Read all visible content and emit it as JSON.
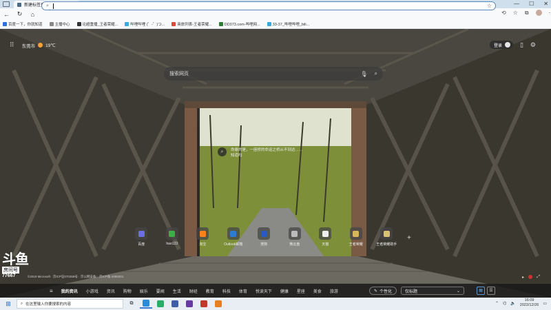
{
  "browser": {
    "tab_title": "新建标签页",
    "new_tab_symbol": "+",
    "close_symbol": "×",
    "window_controls": [
      "—",
      "☐",
      "✕"
    ],
    "nav": {
      "back": "←",
      "forward": "→",
      "refresh": "↻",
      "home": "⌂"
    },
    "address_value": "",
    "address_icon": "search-icon",
    "star": "☆",
    "right_icons": [
      "⟲",
      "☆",
      "⧉"
    ]
  },
  "bookmarks": [
    {
      "label": "百度一下，你就知道",
      "color": "#2f6fdc"
    },
    {
      "label": "主播中心",
      "color": "#888888"
    },
    {
      "label": "论超重播_王者荣耀...",
      "color": "#333333"
    },
    {
      "label": "哔哩哔哩 (゜-゜)つ...",
      "color": "#3da7e0"
    },
    {
      "label": "商旅列表-王者荣耀...",
      "color": "#d9493a"
    },
    {
      "label": "DD373.com-哔哩网...",
      "color": "#2e7d32"
    },
    {
      "label": "33-37_哔哩哔哩_bili...",
      "color": "#3da7e0"
    }
  ],
  "page": {
    "city": "东莞市",
    "temperature": "19℃",
    "login_label": "登录",
    "search_placeholder": "搜索网页",
    "info_line1": "命悬的是，一座桥的命运之桥从不到达……",
    "info_line2": "知道吗",
    "tiles": [
      {
        "label": "百度",
        "color": "#6b6fe0"
      },
      {
        "label": "hao123",
        "color": "#3fae49"
      },
      {
        "label": "淘宝",
        "color": "#f58220"
      },
      {
        "label": "Outlook邮箱",
        "color": "#2c7cd6"
      },
      {
        "label": "搜狗",
        "color": "#2b59c3"
      },
      {
        "label": "微云盘",
        "color": "#bbbbbb"
      },
      {
        "label": "天猫",
        "color": "#eeeeee"
      },
      {
        "label": "王者荣耀",
        "color": "#d8b65b"
      },
      {
        "label": "王者荣耀助手",
        "color": "#d8c27a"
      }
    ],
    "add_symbol": "+",
    "watermark_logo": "斗鱼",
    "watermark_sub": "房间号",
    "watermark_num": "77667",
    "copyright": "©2019 Microsoft · 京ICP证070359号 · 京公网安备：京ICP备-2085001",
    "feed_categories": [
      "我的资讯",
      "小游戏",
      "资讯",
      "购物",
      "娱乐",
      "要闻",
      "生活",
      "财经",
      "教育",
      "科技",
      "体育",
      "悦读天下",
      "健康",
      "星座",
      "美食",
      "旅游"
    ],
    "personalize_label": "个性化",
    "layout_select": "仅标题",
    "view_modes": [
      "▦",
      "☰"
    ]
  },
  "taskbar": {
    "start_symbol": "⊞",
    "search_placeholder": "在这里输入你要搜索的内容",
    "apps": [
      {
        "name": "edge",
        "color": "#2a8bd9"
      },
      {
        "name": "wechat",
        "color": "#2aae67"
      },
      {
        "name": "app3",
        "color": "#3f5ea7"
      },
      {
        "name": "app4",
        "color": "#6a3aa3"
      },
      {
        "name": "app5",
        "color": "#c0392b"
      },
      {
        "name": "app6",
        "color": "#e67e22"
      }
    ],
    "time": "16:09",
    "date": "2022/12/26"
  }
}
